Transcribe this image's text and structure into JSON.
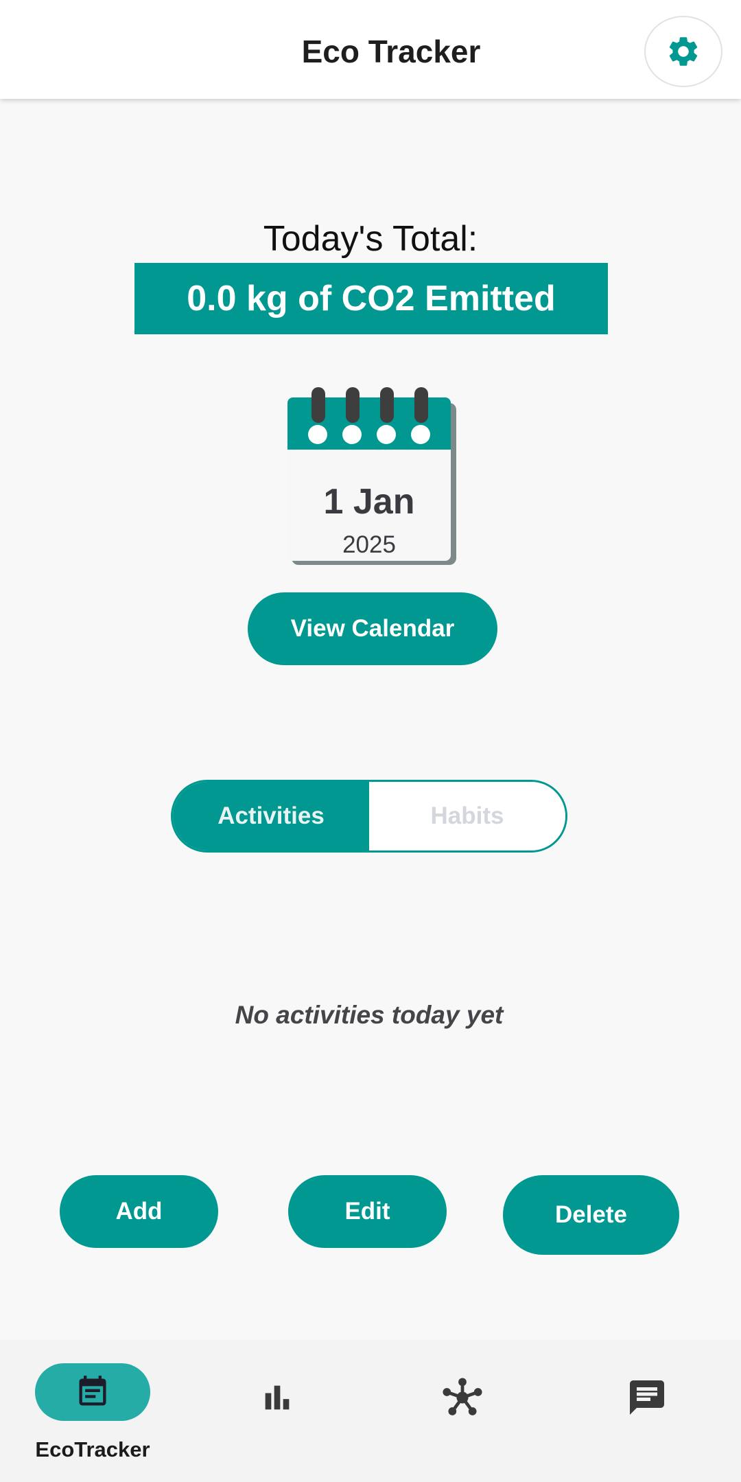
{
  "header": {
    "title": "Eco Tracker",
    "settings_icon": "gear-icon"
  },
  "summary": {
    "label": "Today's Total:",
    "total_text": "0.0 kg of CO2 Emitted"
  },
  "calendar": {
    "day": "1 Jan",
    "year": "2025",
    "icon": "calendar-icon",
    "button_label": "View Calendar"
  },
  "tabs": {
    "activities": "Activities",
    "habits": "Habits",
    "selected": "Activities"
  },
  "list": {
    "empty_message": "No activities today yet"
  },
  "actions": {
    "add": "Add",
    "edit": "Edit",
    "delete": "Delete"
  },
  "bottom_nav": {
    "items": [
      {
        "label": "EcoTracker",
        "icon": "notes-icon",
        "active": true
      },
      {
        "label": "",
        "icon": "bar-chart-icon",
        "active": false
      },
      {
        "label": "",
        "icon": "network-icon",
        "active": false
      },
      {
        "label": "",
        "icon": "chat-icon",
        "active": false
      }
    ]
  },
  "colors": {
    "accent": "#009891",
    "nav_active": "#26aca7",
    "background": "#f8f8f8"
  }
}
